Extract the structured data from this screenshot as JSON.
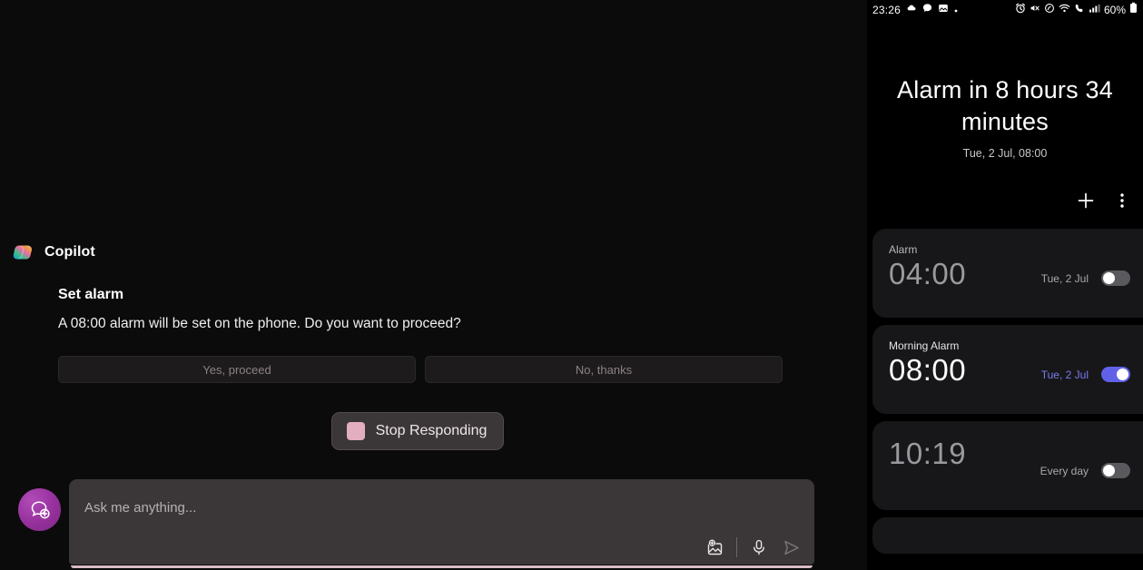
{
  "copilot": {
    "assistant_name": "Copilot",
    "logo_icon": "copilot-logo-icon",
    "message": {
      "title": "Set alarm",
      "body": "A 08:00 alarm will be set on the phone. Do you want to proceed?"
    },
    "choices": [
      {
        "label": "Yes, proceed",
        "name": "yes-proceed-button"
      },
      {
        "label": "No, thanks",
        "name": "no-thanks-button"
      }
    ],
    "stop_button": {
      "label": "Stop Responding",
      "icon": "stop-square-icon"
    },
    "composer": {
      "new_chat_icon": "new-chat-bubble-plus-icon",
      "placeholder": "Ask me anything...",
      "value": "",
      "add_image_icon": "add-image-icon",
      "mic_icon": "microphone-icon",
      "send_icon": "send-icon"
    },
    "colors": {
      "accent_pink": "#d9bcc4",
      "stop_square": "#e3afc0",
      "new_chat_purple": "#96309c"
    }
  },
  "clock": {
    "statusbar": {
      "time": "23:26",
      "left_icons": [
        "cloud-icon",
        "message-bubble-icon",
        "image-icon",
        "dot-icon"
      ],
      "right_icons": [
        "alarm-clock-icon",
        "mute-icon",
        "nfc-icon",
        "wifi-icon",
        "call-icon",
        "signal-icon"
      ],
      "battery_text": "60%",
      "battery_icon": "battery-icon"
    },
    "header": {
      "title": "Alarm in 8 hours 34 minutes",
      "subtitle": "Tue, 2 Jul, 08:00"
    },
    "actions": [
      {
        "name": "add-alarm-button",
        "icon": "plus-icon"
      },
      {
        "name": "more-options-button",
        "icon": "overflow-menu-icon"
      }
    ],
    "alarms": [
      {
        "label": "Alarm",
        "time": "04:00",
        "days": "Tue, 2 Jul",
        "enabled": false
      },
      {
        "label": "Morning Alarm",
        "time": "08:00",
        "days": "Tue, 2 Jul",
        "enabled": true
      },
      {
        "label": "",
        "time": "10:19",
        "days": "Every day",
        "enabled": false
      }
    ],
    "colors": {
      "toggle_on": "#6161e8",
      "card_bg": "#17171a"
    }
  }
}
